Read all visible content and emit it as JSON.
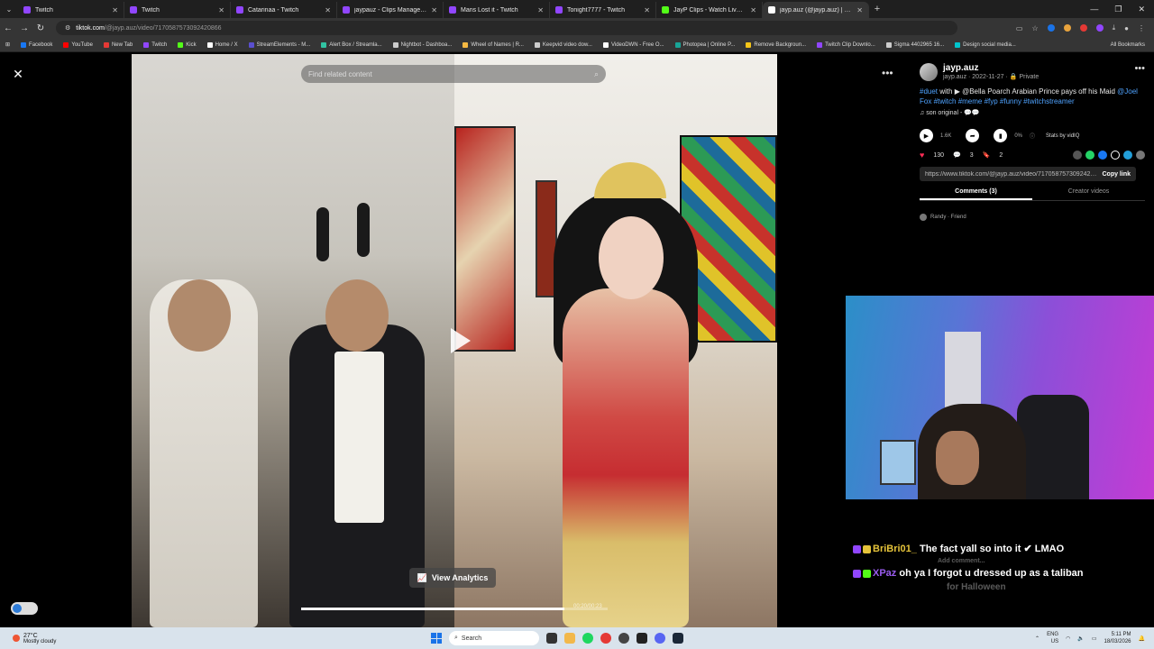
{
  "tabs": [
    {
      "title": "Twitch",
      "color": "#9146ff",
      "active": false
    },
    {
      "title": "Twitch",
      "color": "#9146ff",
      "active": false
    },
    {
      "title": "Catarinaa - Twitch",
      "color": "#9146ff",
      "active": false
    },
    {
      "title": "jaypauz - Clips Manager - Twit",
      "color": "#9146ff",
      "active": false
    },
    {
      "title": "Mans Lost it - Twitch",
      "color": "#9146ff",
      "active": false
    },
    {
      "title": "Tonight7777 - Twitch",
      "color": "#9146ff",
      "active": false
    },
    {
      "title": "JayP Clips - Watch Live on Kick",
      "color": "#53fc18",
      "active": false
    },
    {
      "title": "jayp.auz (@jayp.auz) | TikTok",
      "color": "#ffffff",
      "active": true
    }
  ],
  "address": {
    "host": "tiktok.com",
    "path": "/@jayp.auz/video/7170587573092420866"
  },
  "bookmarks": [
    {
      "label": "Facebook",
      "color": "#1877f2"
    },
    {
      "label": "YouTube",
      "color": "#ff0000"
    },
    {
      "label": "New Tab",
      "color": "#e53935"
    },
    {
      "label": "Twitch",
      "color": "#9146ff"
    },
    {
      "label": "Kick",
      "color": "#53fc18"
    },
    {
      "label": "Home / X",
      "color": "#ffffff"
    },
    {
      "label": "StreamElements - M...",
      "color": "#5a4fcf"
    },
    {
      "label": "Alert Box / Streamla...",
      "color": "#31c3a2"
    },
    {
      "label": "Nightbot - Dashboa...",
      "color": "#cccccc"
    },
    {
      "label": "Wheel of Names | R...",
      "color": "#f5b942"
    },
    {
      "label": "Keepvid video dow...",
      "color": "#cccccc"
    },
    {
      "label": "VideoDWN - Free O...",
      "color": "#ffffff"
    },
    {
      "label": "Photopea | Online P...",
      "color": "#18a497"
    },
    {
      "label": "Remove Backgroun...",
      "color": "#f5c518"
    },
    {
      "label": "Twitch Clip Downlo...",
      "color": "#9146ff"
    },
    {
      "label": "Sigma 4402965 16...",
      "color": "#cccccc"
    },
    {
      "label": "Design social media...",
      "color": "#00c4cc"
    }
  ],
  "bookmarks_all": "All Bookmarks",
  "player": {
    "search_placeholder": "Find related content",
    "analytics_label": "View Analytics",
    "progress": 0.86,
    "time": "00:20/00:23"
  },
  "profile": {
    "username": "jayp.auz",
    "meta": "jayp.auz · 2022-11-27 · 🔒 Private"
  },
  "description": {
    "duet": "#duet",
    "with": " with ",
    "mention1": "▶ @Bella Poarch",
    "text": " Arabian Prince pays off his Maid ",
    "mention2": "@Joel Fox",
    "tags": " #twitch #meme #fyp #funny #twitchstreamer"
  },
  "song": "♫ son original - 💬💬",
  "stats": {
    "views": "1.6K",
    "rate": "0%",
    "label": "Stats by vidIQ"
  },
  "actions": {
    "likes": "130",
    "comments": "3",
    "saves": "2"
  },
  "link": {
    "url": "https://www.tiktok.com/@jayp.auz/video/7170587573092420866",
    "copy_label": "Copy link"
  },
  "side_tabs": {
    "comments": "Comments (3)",
    "creator": "Creator videos"
  },
  "comment_preview": "Randy · Friend",
  "chat": [
    {
      "name": "BriBri01_",
      "message": " The fact yall so into it ✔ LMAO"
    },
    {
      "name": "XPaz",
      "message": " oh ya I forgot u dressed up as a taliban"
    },
    {
      "faint": "for Halloween"
    }
  ],
  "add_comment": "Add comment...",
  "taskbar": {
    "temp": "27°C",
    "weather": "Mostly cloudy",
    "search": "Search",
    "lang1": "ENG",
    "lang2": "US",
    "time": "5:11 PM",
    "date": "18/03/2026"
  }
}
